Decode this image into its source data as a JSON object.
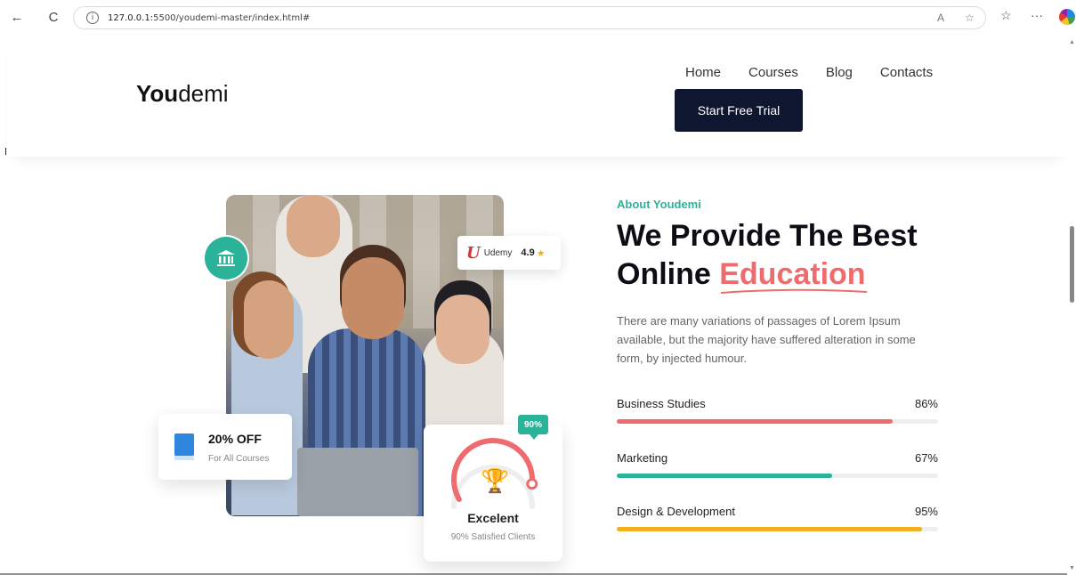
{
  "browser": {
    "url_host": "127.0.0.1",
    "url_rest": ":5500/youdemi-master/index.html#",
    "back_icon": "←",
    "refresh_icon": "C",
    "info_icon": "i",
    "read_aloud_icon": "A",
    "favorite_icon": "☆",
    "favorites_icon": "☆",
    "more_icon": "···"
  },
  "header": {
    "logo_bold": "You",
    "logo_rest": "demi",
    "menu": [
      "Home",
      "Courses",
      "Blog",
      "Contacts"
    ],
    "cta": "Start Free Trial"
  },
  "hero_cards": {
    "udemy_logo": "U",
    "udemy_name": "Udemy",
    "udemy_rating": "4.9",
    "udemy_star": "★",
    "offer_title": "20% OFF",
    "offer_sub": "For All Courses",
    "score_pct": "90%",
    "score_value": 0.9,
    "score_title": "Excelent",
    "score_sub": "90% Satisfied Clients"
  },
  "about": {
    "eyebrow": "About Youdemi",
    "headline_line1": "We Provide The Best",
    "headline_line2_plain": "Online ",
    "headline_line2_accent": "Education",
    "description": "There are many variations of passages of Lorem Ipsum available, but the majority have suffered alteration in some form, by injected humour.",
    "skills": [
      {
        "label": "Business Studies",
        "percent_text": "86%",
        "value": 86,
        "color": "#ee6b6e"
      },
      {
        "label": "Marketing",
        "percent_text": "67%",
        "value": 67,
        "color": "#2bb39a"
      },
      {
        "label": "Design & Development",
        "percent_text": "95%",
        "value": 95,
        "color": "#f2b01e"
      }
    ]
  },
  "colors": {
    "accent_teal": "#2bb39a",
    "accent_coral": "#ee6b6e",
    "navy": "#0e1630"
  }
}
